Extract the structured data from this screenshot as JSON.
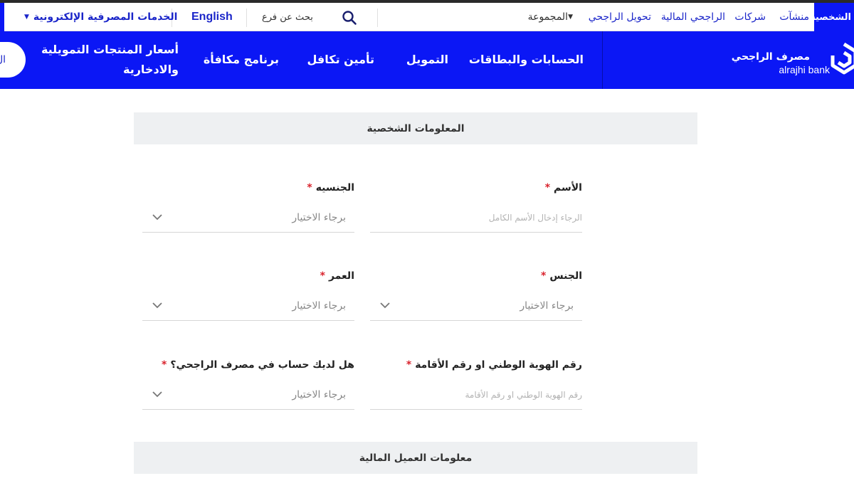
{
  "topbar": {
    "active_tab": "الشخصية",
    "links": [
      "منشآت",
      "شركات",
      "الراجحي المالية",
      "تحويل الراجحي"
    ],
    "group_menu": "المجموعة",
    "search_label": "بحث عن فرع",
    "language": "English",
    "eservices": "الخدمات المصرفية الإلكترونية"
  },
  "logo": {
    "arabic": "مصرف الراجحي",
    "english": "alrajhi bank"
  },
  "nav": {
    "items": [
      "الحسابات والبطاقات",
      "التمويل",
      "تأمين تكافل",
      "برنامج مكافأة"
    ],
    "prices_line1": "أسعار المنتجات التمويلية",
    "prices_line2": "والادخارية",
    "pill_text": "ال"
  },
  "form": {
    "section_personal": "المعلومات الشخصية",
    "section_financial": "معلومات العميل المالية",
    "required_mark": "*",
    "name": {
      "label": "الأسم",
      "placeholder": "الرجاء إدخال الأسم الكامل"
    },
    "nationality": {
      "label": "الجنسيه",
      "value": "برجاء الاختيار"
    },
    "gender": {
      "label": "الجنس",
      "value": "برجاء الاختيار"
    },
    "age": {
      "label": "العمر",
      "value": "برجاء الاختيار"
    },
    "national_id": {
      "label": "رقم الهوية الوطني او رقم الأقامة",
      "placeholder": "رقم الهوية الوطني او رقم الأقامة"
    },
    "has_account": {
      "label": "هل لديك حساب في مصرف الراجحي؟",
      "value": "برجاء الاختيار"
    }
  },
  "colors": {
    "brand_blue": "#0b17f5",
    "required_red": "#d9232d",
    "section_bg": "#eef0f2"
  }
}
